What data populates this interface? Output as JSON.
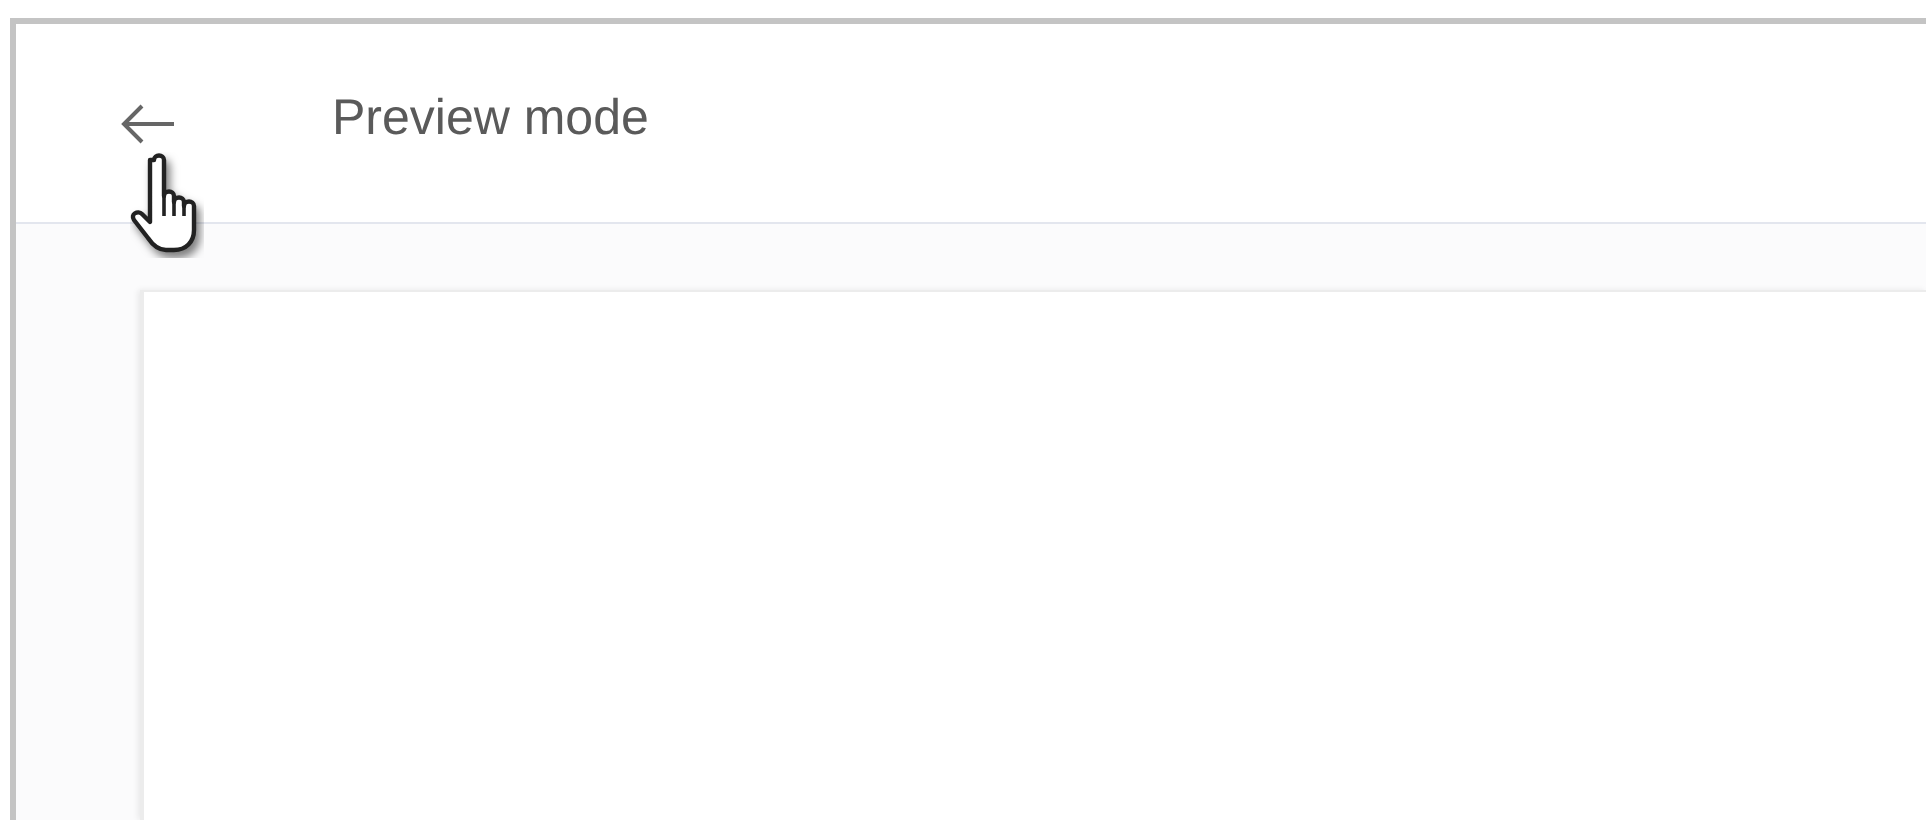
{
  "header": {
    "title": "Preview mode"
  }
}
